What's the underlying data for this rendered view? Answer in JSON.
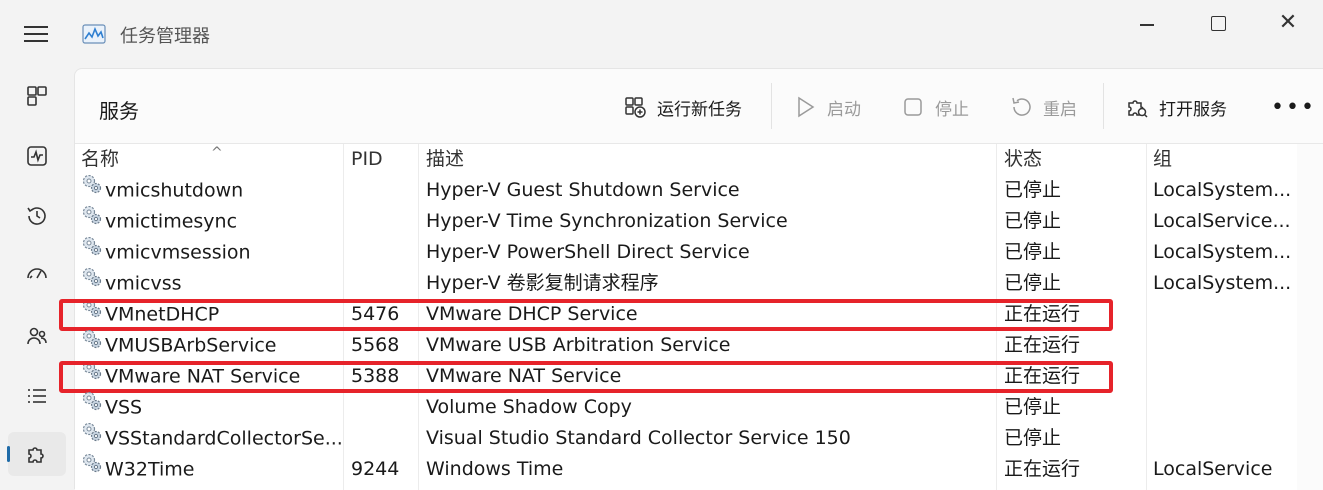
{
  "window": {
    "title": "任务管理器",
    "close_glyph": "✕"
  },
  "nav": {
    "items": [
      {
        "id": "processes",
        "icon": "grid-icon"
      },
      {
        "id": "performance",
        "icon": "pulse-icon"
      },
      {
        "id": "app-history",
        "icon": "history-icon"
      },
      {
        "id": "startup",
        "icon": "speedometer-icon"
      },
      {
        "id": "users",
        "icon": "users-icon"
      },
      {
        "id": "details",
        "icon": "list-icon"
      },
      {
        "id": "services",
        "icon": "puzzle-icon",
        "active": true
      }
    ]
  },
  "page": {
    "title": "服务"
  },
  "toolbar": {
    "run_new_task": "运行新任务",
    "start": "启动",
    "stop": "停止",
    "restart": "重启",
    "open_services": "打开服务",
    "more": "•••"
  },
  "table": {
    "columns": {
      "name": "名称",
      "pid": "PID",
      "desc": "描述",
      "status": "状态",
      "group": "组"
    },
    "sort_arrow": "^",
    "rows": [
      {
        "name": "vmicshutdown",
        "pid": "",
        "desc": "Hyper-V Guest Shutdown Service",
        "status": "已停止",
        "group": "LocalSystem..."
      },
      {
        "name": "vmictimesync",
        "pid": "",
        "desc": "Hyper-V Time Synchronization Service",
        "status": "已停止",
        "group": "LocalService..."
      },
      {
        "name": "vmicvmsession",
        "pid": "",
        "desc": "Hyper-V PowerShell Direct Service",
        "status": "已停止",
        "group": "LocalSystem..."
      },
      {
        "name": "vmicvss",
        "pid": "",
        "desc": "Hyper-V 卷影复制请求程序",
        "status": "已停止",
        "group": "LocalSystem..."
      },
      {
        "name": "VMnetDHCP",
        "pid": "5476",
        "desc": "VMware DHCP Service",
        "status": "正在运行",
        "group": "",
        "highlighted": true
      },
      {
        "name": "VMUSBArbService",
        "pid": "5568",
        "desc": "VMware USB Arbitration Service",
        "status": "正在运行",
        "group": ""
      },
      {
        "name": "VMware NAT Service",
        "pid": "5388",
        "desc": "VMware NAT Service",
        "status": "正在运行",
        "group": "",
        "highlighted": true
      },
      {
        "name": "VSS",
        "pid": "",
        "desc": "Volume Shadow Copy",
        "status": "已停止",
        "group": ""
      },
      {
        "name": "VSStandardCollectorSe...",
        "pid": "",
        "desc": "Visual Studio Standard Collector Service 150",
        "status": "已停止",
        "group": ""
      },
      {
        "name": "W32Time",
        "pid": "9244",
        "desc": "Windows Time",
        "status": "正在运行",
        "group": "LocalService"
      }
    ]
  },
  "colors": {
    "highlight": "#e6232a",
    "accent": "#1f6ba8"
  }
}
